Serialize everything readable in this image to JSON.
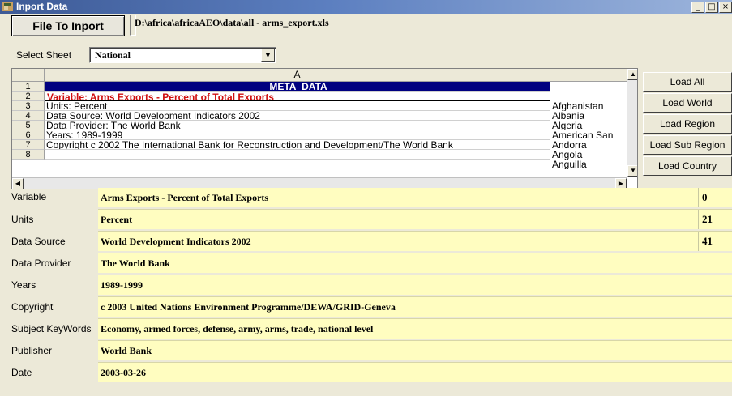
{
  "window": {
    "title": "Inport Data",
    "controls": {
      "minimize": "_",
      "maximize": "□",
      "close": "×"
    }
  },
  "file": {
    "button_label": "File To Inport",
    "path": "D:\\africa\\africaAEO\\data\\all - arms_export.xls"
  },
  "sheet": {
    "label": "Select Sheet",
    "selected": "National"
  },
  "grid": {
    "column_header": "A",
    "rows": [
      {
        "num": "1",
        "text": "META_DATA"
      },
      {
        "num": "2",
        "text": "Variable: Arms Exports - Percent of Total Exports"
      },
      {
        "num": "3",
        "text": "Units: Percent"
      },
      {
        "num": "4",
        "text": "Data Source: World Development Indicators 2002"
      },
      {
        "num": "5",
        "text": "Data Provider: The World Bank"
      },
      {
        "num": "6",
        "text": "Years: 1989-1999"
      },
      {
        "num": "7",
        "text": "Copyright c 2002 The International Bank for Reconstruction and Development/The World Bank"
      },
      {
        "num": "8",
        "text": ""
      }
    ],
    "countries": [
      "Afghanistan",
      "Albania",
      "Algeria",
      "American San",
      "Andorra",
      "Angola",
      "Anguilla"
    ]
  },
  "load_buttons": [
    "Load All",
    "Load World",
    "Load Region",
    "Load Sub Region",
    "Load Country"
  ],
  "fields": [
    {
      "label": "Variable",
      "value": "Arms Exports - Percent of Total Exports"
    },
    {
      "label": "Units",
      "value": "Percent"
    },
    {
      "label": "Data Source",
      "value": "World Development Indicators 2002"
    },
    {
      "label": "Data Provider",
      "value": "The World Bank"
    },
    {
      "label": "Years",
      "value": "1989-1999"
    },
    {
      "label": "Copyright",
      "value": "c 2003 United Nations Environment Programme/DEWA/GRID-Geneva"
    },
    {
      "label": "Subject KeyWords",
      "value": "Economy, armed forces, defense, army, arms, trade, national level"
    },
    {
      "label": "Publisher",
      "value": "World Bank"
    },
    {
      "label": "Date",
      "value": "2003-03-26"
    }
  ],
  "side_numbers": [
    "0",
    "21",
    "41"
  ],
  "colors": {
    "titlebar": "#3d5a96",
    "meta_header_bg": "#000080",
    "variable_text": "#d01010",
    "field_bg": "#fffdc0"
  },
  "icons": {
    "app": "app-icon",
    "dropdown": "chevron-down-icon",
    "scroll_up": "arrow-up-icon",
    "scroll_down": "arrow-down-icon",
    "scroll_left": "arrow-left-icon",
    "scroll_right": "arrow-right-icon"
  }
}
